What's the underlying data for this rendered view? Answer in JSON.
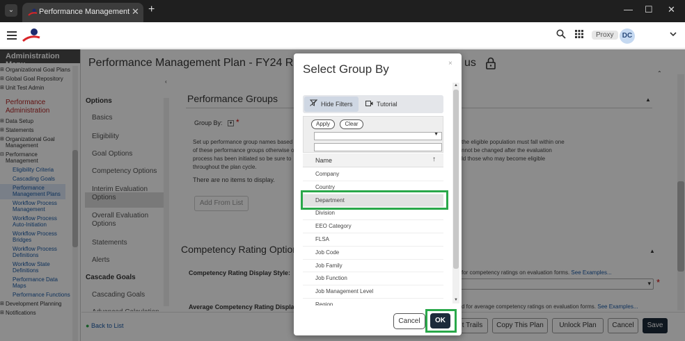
{
  "browser": {
    "tab_title": "Performance Management Plan",
    "tab_close": "✕",
    "new_tab": "+",
    "window_controls": [
      "—",
      "☐",
      "✕"
    ],
    "tab_menu": "⌄"
  },
  "header": {
    "proxy_label": "Proxy",
    "avatar_initials": "DC"
  },
  "admin_menu": {
    "title": "Administration Menu",
    "items": [
      {
        "label": "Organizational Goal Plans",
        "type": "plus"
      },
      {
        "label": "Global Goal Repository",
        "type": "plus"
      },
      {
        "label": "Unit Test Admin",
        "type": "plus"
      },
      {
        "label": "Performance Administration",
        "type": "sect"
      },
      {
        "label": "Data Setup",
        "type": "plus"
      },
      {
        "label": "Statements",
        "type": "plus"
      },
      {
        "label": "Organizational Goal Management",
        "type": "plus"
      },
      {
        "label": "Performance Management",
        "type": "minus"
      },
      {
        "label": "Eligibility Criteria",
        "type": "sub"
      },
      {
        "label": "Cascading Goals",
        "type": "sub"
      },
      {
        "label": "Performance Management Plans",
        "type": "sub-active"
      },
      {
        "label": "Workflow Process Management",
        "type": "sub"
      },
      {
        "label": "Workflow Process Auto-Initiation",
        "type": "sub"
      },
      {
        "label": "Workflow Process Bridges",
        "type": "sub"
      },
      {
        "label": "Workflow Process Definitions",
        "type": "sub"
      },
      {
        "label": "Workflow State Definitions",
        "type": "sub"
      },
      {
        "label": "Performance Data Maps",
        "type": "sub"
      },
      {
        "label": "Performance Functions",
        "type": "sub"
      },
      {
        "label": "Development Planning",
        "type": "plus"
      },
      {
        "label": "Notifications",
        "type": "plus"
      }
    ]
  },
  "page": {
    "title": "Performance Management Plan - FY24 Rewa",
    "title_tail": "us",
    "subnav": {
      "group_options": "Options",
      "items": [
        "Basics",
        "Eligibility",
        "Goal Options",
        "Competency Options",
        "Interim Evaluation Options",
        "Overall Evaluation Options",
        "Statements",
        "Alerts"
      ],
      "group_cascade": "Cascade Goals",
      "cascade_items": [
        "Cascading Goals",
        "Advanced Calculation"
      ]
    },
    "performance_groups_title": "Performance Groups",
    "group_by_label": "Group By:",
    "group_by_box": "▾",
    "setup_text_left": [
      "Set up performance group names based",
      "of these performance groups otherwise o",
      "process has been initiated so be sure to",
      "throughout the plan cycle."
    ],
    "setup_text_right": [
      "the eligible population must fall within one",
      "nnot be changed after the evaluation",
      "ld those who may become eligible"
    ],
    "no_items": "There are no items to display.",
    "add_from_list": "Add From List",
    "competency_title": "Competency Rating Options",
    "display_style_label": "Competency Rating Display Style:",
    "display_style_hint": "for competency ratings on evaluation forms.",
    "avg_label": "Average Competency Rating Display Fo",
    "avg_hint": "d for average competency ratings on evaluation forms.",
    "see_examples": "See Examples...",
    "back_to_list": "Back to List",
    "footer_buttons": [
      "t Trails",
      "Copy This Plan",
      "Unlock Plan",
      "Cancel",
      "Save"
    ]
  },
  "dialog": {
    "title": "Select Group By",
    "close": "×",
    "hide_filters": "Hide Filters",
    "tutorial": "Tutorial",
    "apply": "Apply",
    "clear": "Clear",
    "column_name": "Name",
    "sort_indicator": "↑",
    "rows": [
      "Company",
      "Country",
      "Department",
      "Division",
      "EEO Category",
      "FLSA",
      "Job Code",
      "Job Family",
      "Job Function",
      "Job Management Level",
      "Region"
    ],
    "selected_row": "Department",
    "cancel": "Cancel",
    "ok": "OK"
  }
}
